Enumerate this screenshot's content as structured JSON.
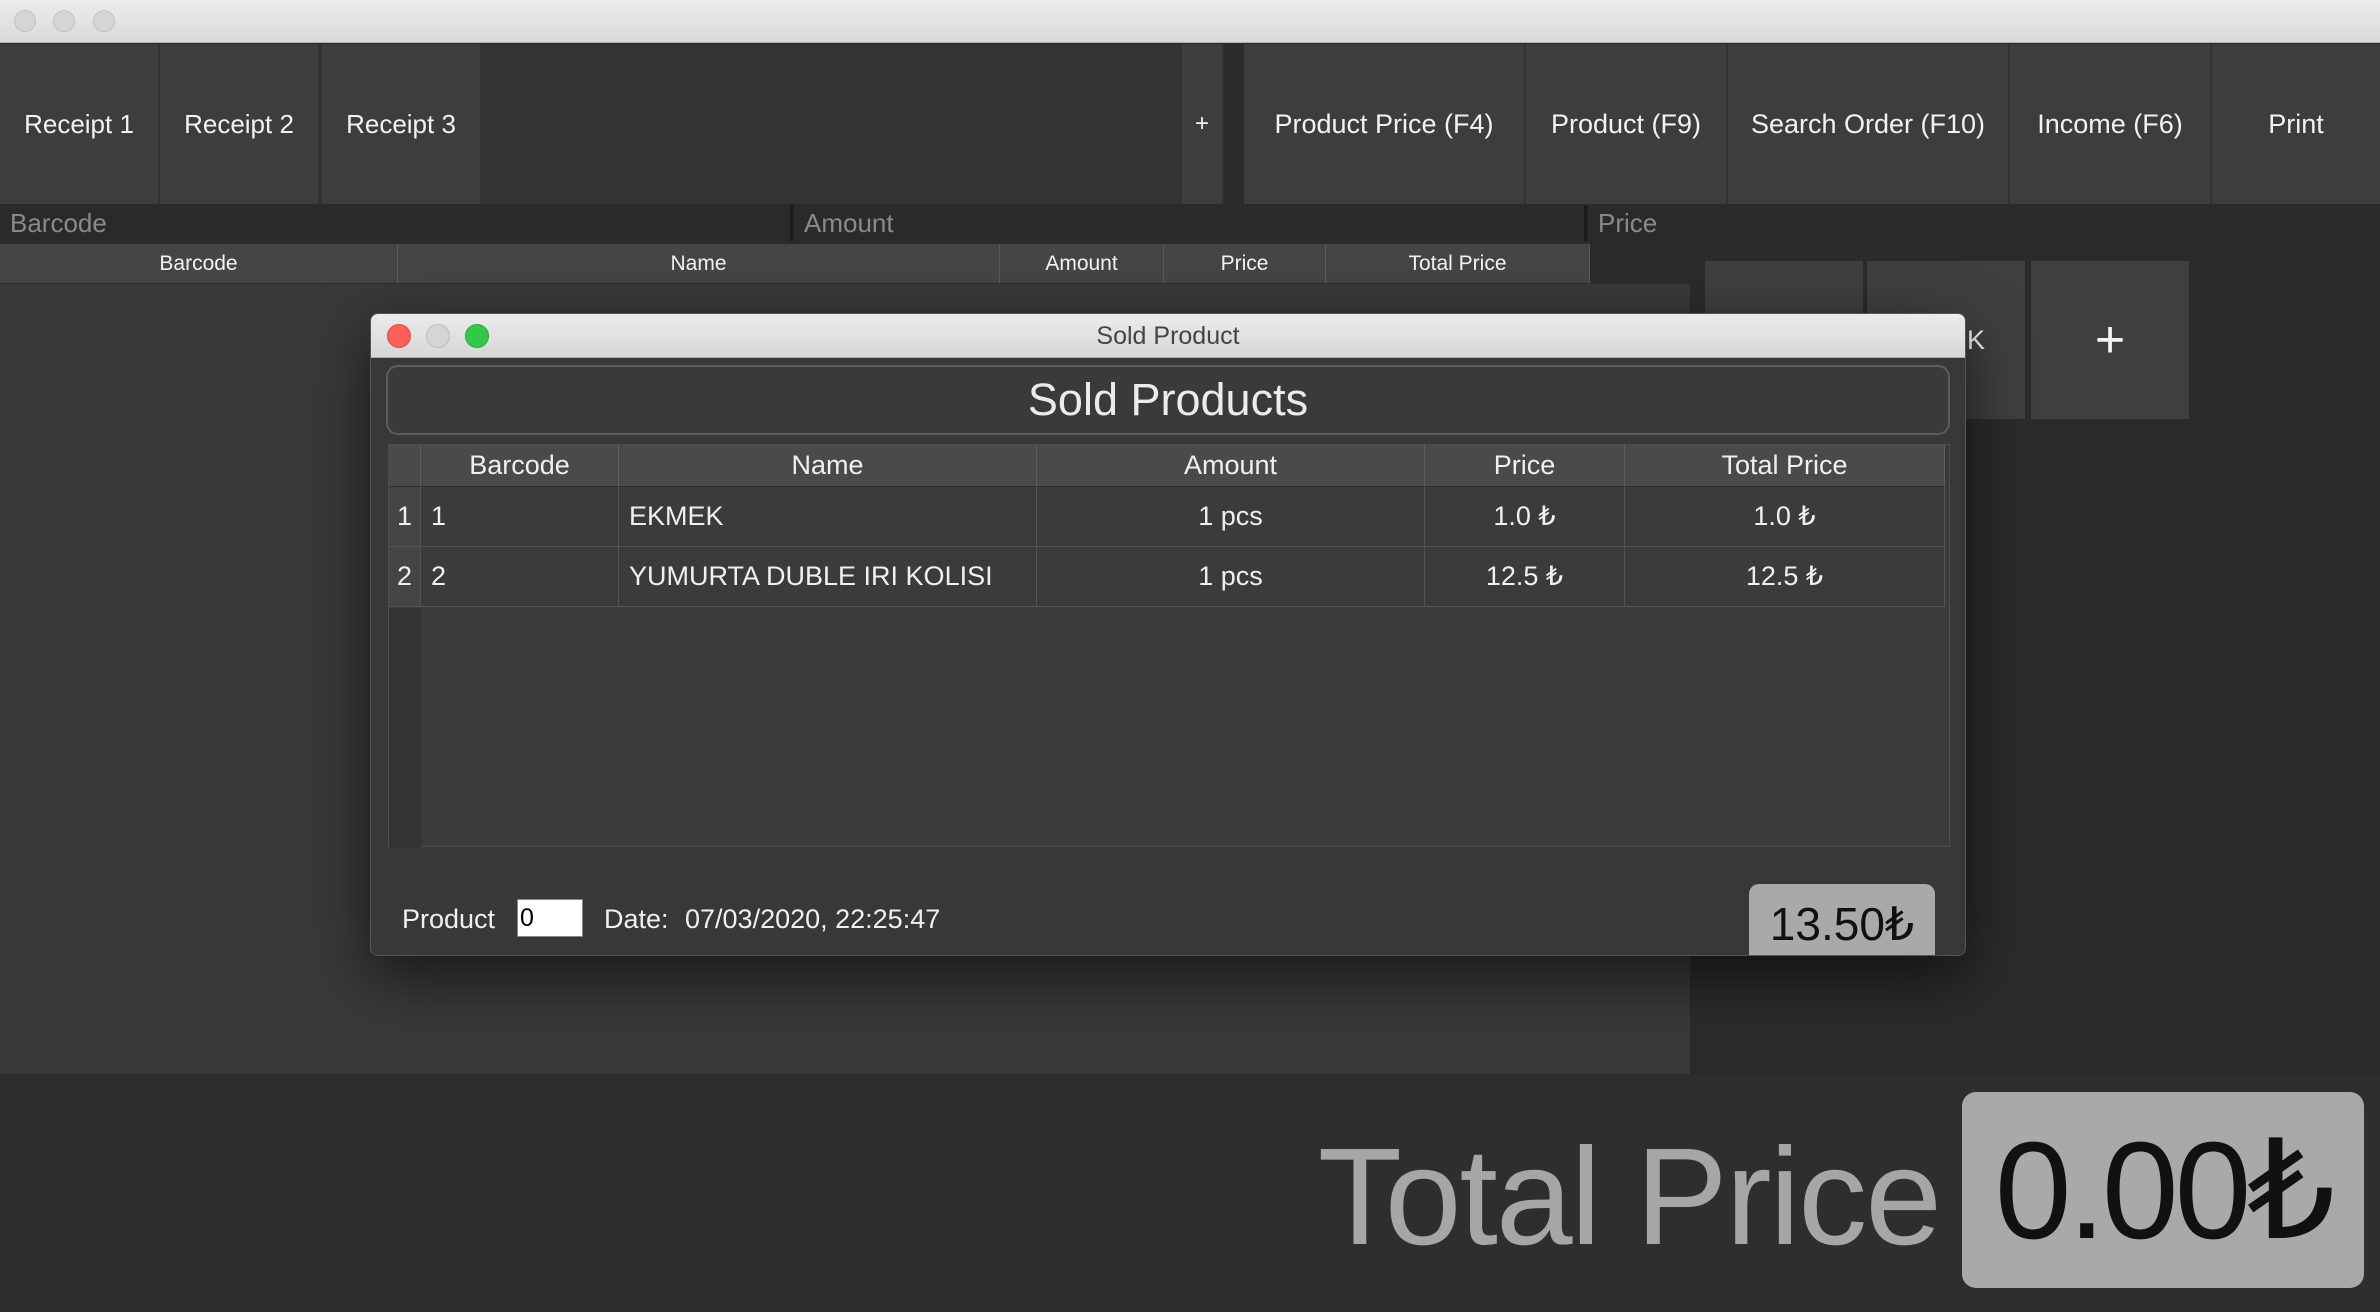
{
  "tabs": [
    {
      "label": "Receipt 1"
    },
    {
      "label": "Receipt 2"
    },
    {
      "label": "Receipt 3"
    }
  ],
  "add_tab_label": "+",
  "toolbar": {
    "product_price": "Product Price (F4)",
    "product": "Product (F9)",
    "search_order": "Search Order (F10)",
    "income": "Income (F6)",
    "print": "Print"
  },
  "inputs": {
    "barcode_placeholder": "Barcode",
    "amount_placeholder": "Amount",
    "price_placeholder": "Price"
  },
  "main_table": {
    "columns": [
      "Barcode",
      "Name",
      "Amount",
      "Price",
      "Total Price"
    ]
  },
  "product_panel": {
    "tile_partial_label": "EK",
    "add_tile_label": "+"
  },
  "total": {
    "label": "Total Price",
    "value": "0.00₺"
  },
  "dialog": {
    "window_title": "Sold Product",
    "heading": "Sold Products",
    "columns": [
      "Barcode",
      "Name",
      "Amount",
      "Price",
      "Total Price"
    ],
    "rows": [
      {
        "index": "1",
        "barcode": "1",
        "name": "EKMEK",
        "amount": "1 pcs",
        "price": "1.0 ₺",
        "total": "1.0 ₺"
      },
      {
        "index": "2",
        "barcode": "2",
        "name": "YUMURTA DUBLE IRI KOLISI",
        "amount": "1 pcs",
        "price": "12.5 ₺",
        "total": "12.5 ₺"
      }
    ],
    "product_label": "Product",
    "product_value": "0",
    "date_label": "Date:",
    "date_value": "07/03/2020, 22:25:47",
    "total_value": "13.50₺"
  }
}
